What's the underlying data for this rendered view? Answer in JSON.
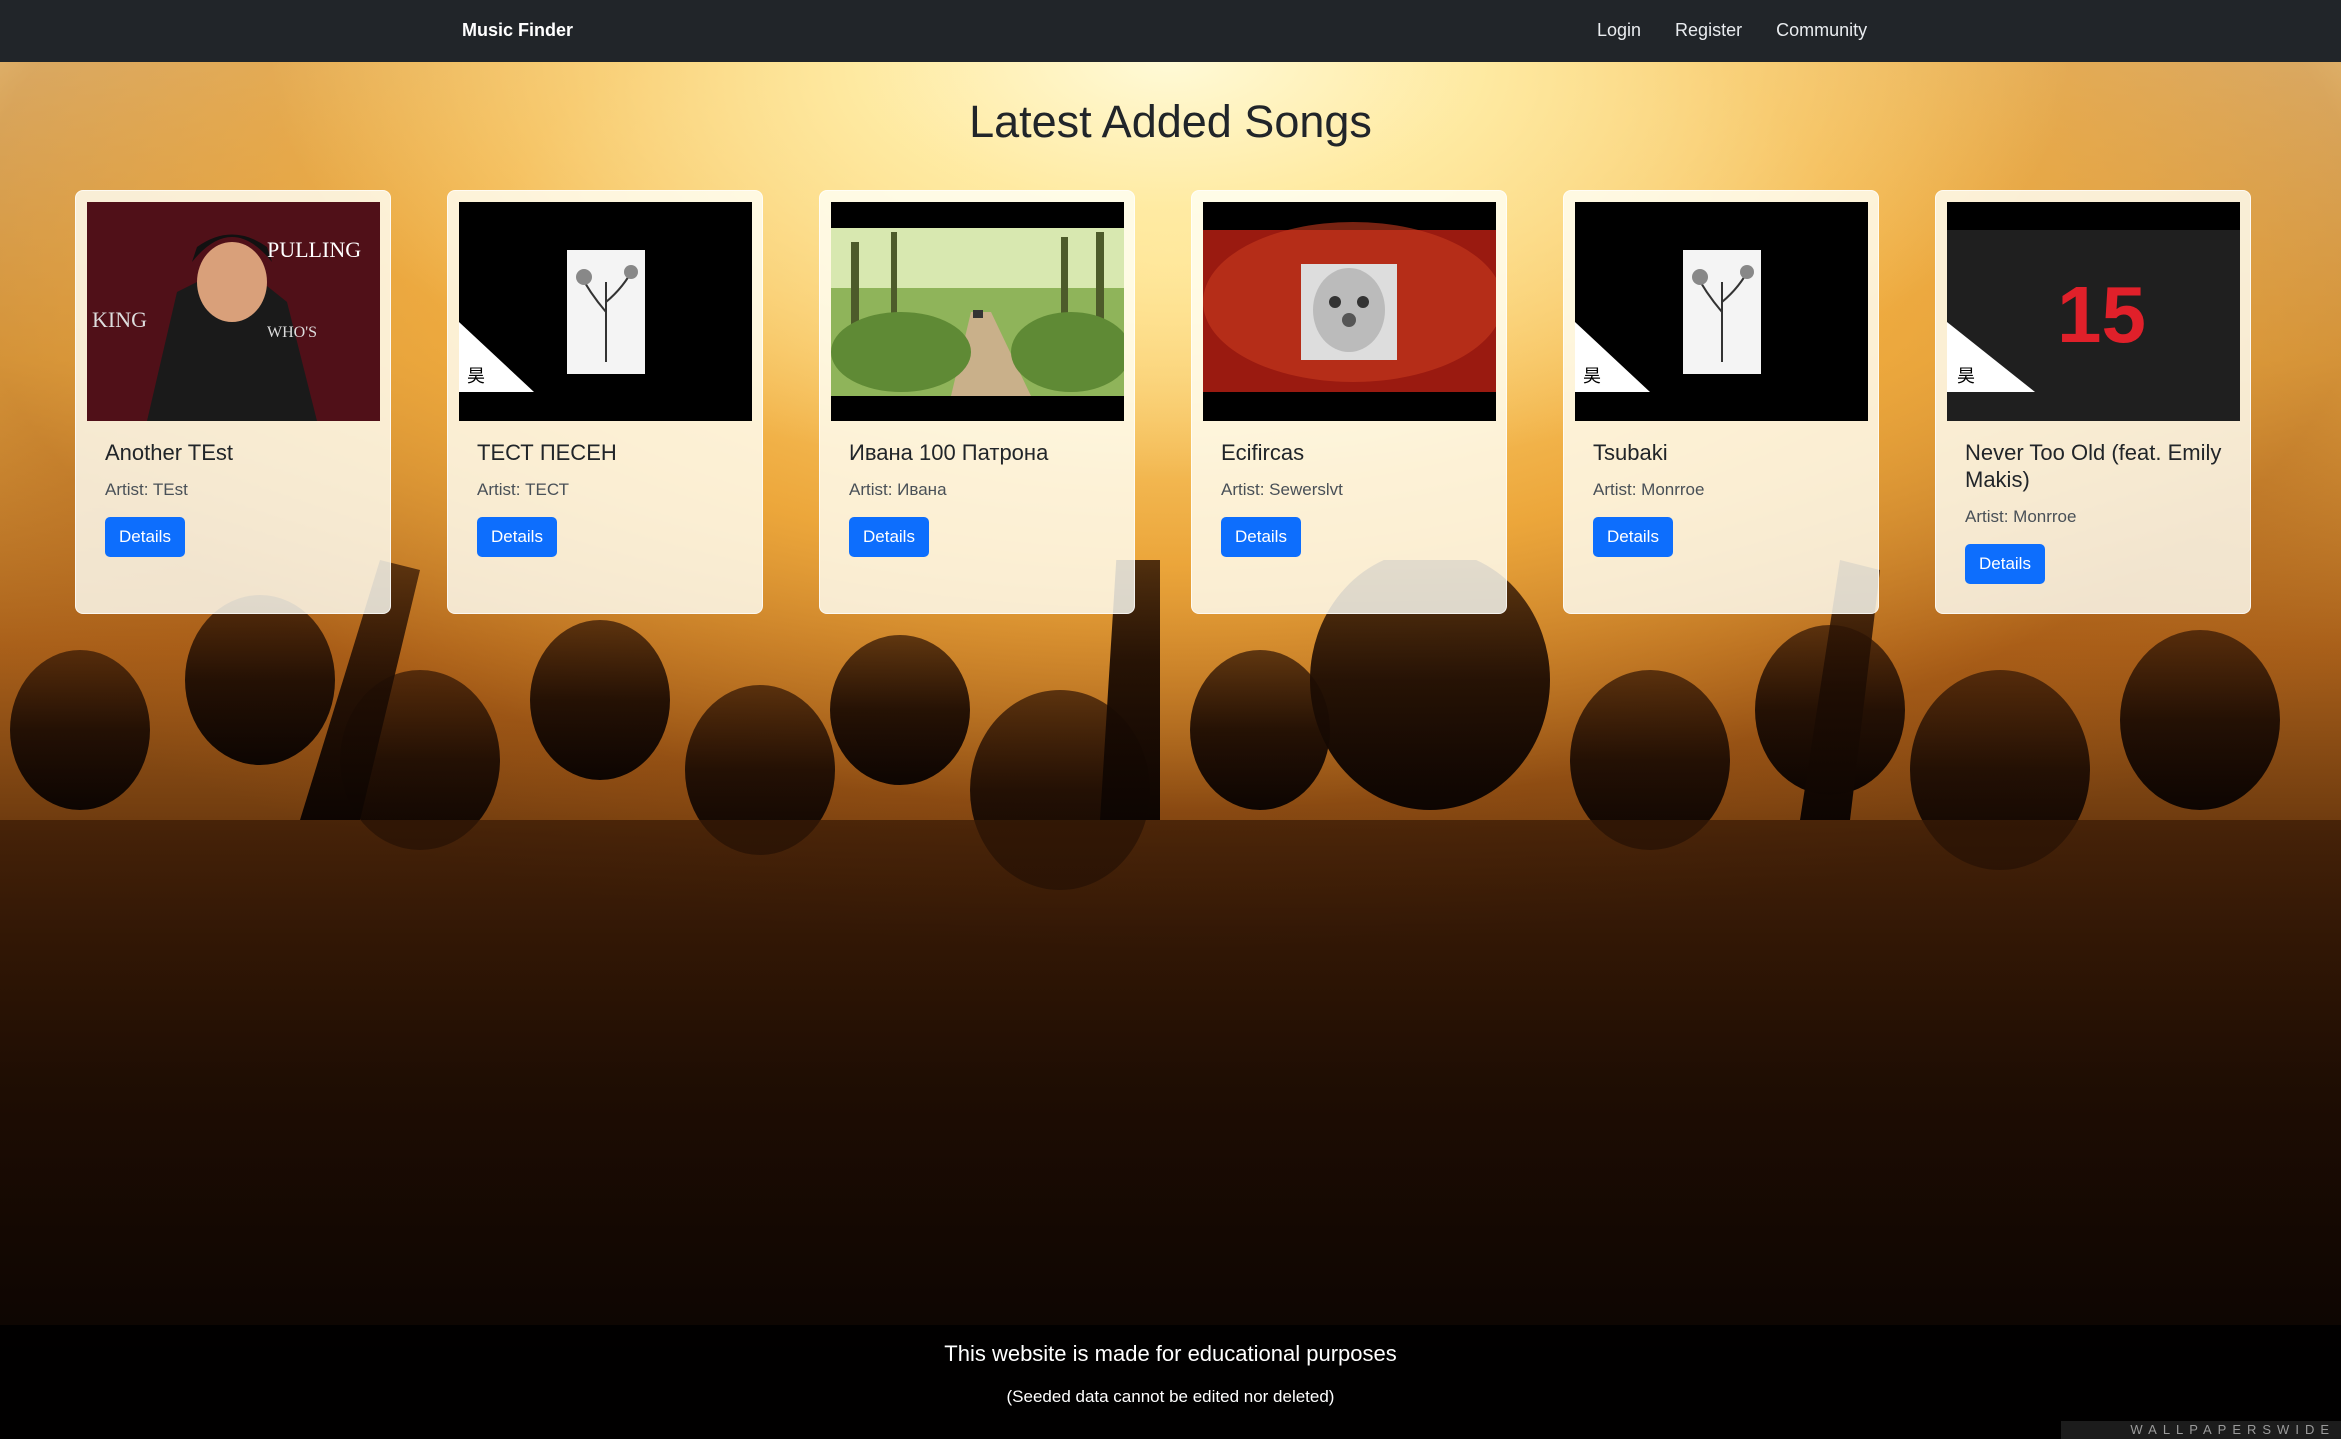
{
  "navbar": {
    "brand": "Music Finder",
    "links": [
      "Login",
      "Register",
      "Community"
    ]
  },
  "main": {
    "title": "Latest Added Songs",
    "songs": [
      {
        "title": "Another TEst",
        "artist": "Artist: TEst",
        "details_label": "Details",
        "thumbnail": "anime-characters"
      },
      {
        "title": "ТЕСТ ПЕСЕН",
        "artist": "Artist: ТЕСТ",
        "details_label": "Details",
        "thumbnail": "flower-sketch"
      },
      {
        "title": "Ивана 100 Патрона",
        "artist": "Artist: Ивана",
        "details_label": "Details",
        "thumbnail": "forest-road"
      },
      {
        "title": "Ecifircas",
        "artist": "Artist: Sewerslvt",
        "details_label": "Details",
        "thumbnail": "clown-face"
      },
      {
        "title": "Tsubaki",
        "artist": "Artist: Monrroe",
        "details_label": "Details",
        "thumbnail": "flower-sketch"
      },
      {
        "title": "Never Too Old (feat. Emily Makis)",
        "artist": "Artist: Monrroe",
        "details_label": "Details",
        "thumbnail": "red-15-logo"
      }
    ]
  },
  "footer": {
    "main": "This website is made for educational purposes",
    "sub": "(Seeded data cannot be edited nor deleted)"
  },
  "watermark": "WALLPAPERSWIDE",
  "colors": {
    "navbar": "#212529",
    "button": "#0d6efd",
    "footer": "#000000"
  }
}
